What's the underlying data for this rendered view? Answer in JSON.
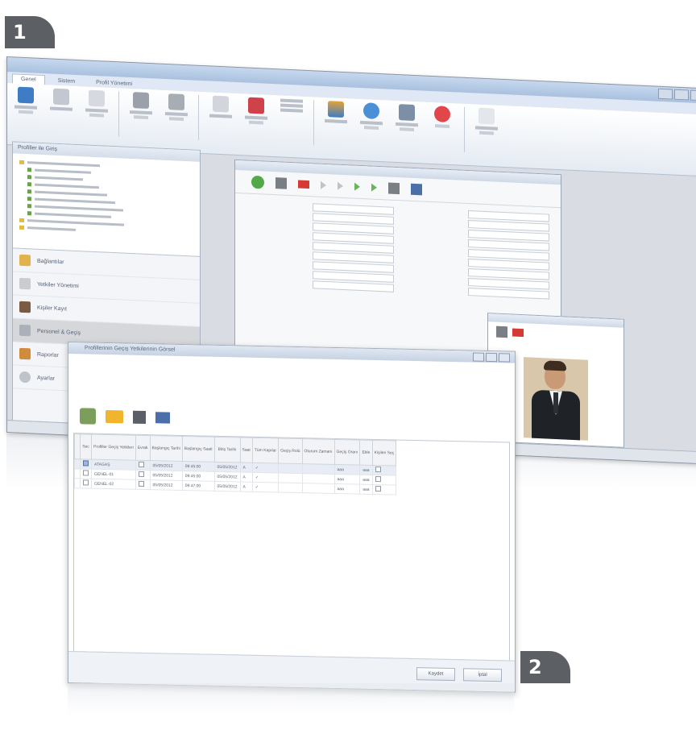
{
  "badges": {
    "one": "1",
    "two": "2"
  },
  "app": {
    "tabs": [
      "Genel",
      "Sistem",
      "Profil Yönetimi"
    ],
    "nav_header": "Profiller ile Giriş",
    "nav_items": [
      "Bağlantılar",
      "Yetkiler Yönetimi",
      "Kişiler Kayıt",
      "Personel & Geçiş",
      "Raporlar",
      "Ayarlar"
    ]
  },
  "dialog": {
    "title": "Profillerinin Geçiş Yetkilerinin Görsel",
    "ok": "Kaydet",
    "cancel": "İptal",
    "columns": [
      "Sec",
      "Profiller Geçiş Yetkileri",
      "Evrak",
      "Başlangıç Tarihi",
      "Başlangıç Saati",
      "Bitiş Tarihi",
      "Saat",
      "Tüm Kapılar",
      "Geçiş Rolü",
      "Oturum Zamanı",
      "Geçiş Oranı",
      "Ekle",
      "Kişileri Seç"
    ],
    "rows": [
      {
        "name": "ATAGAŞ",
        "date1": "05/05/2012",
        "time1": "09:45:00",
        "date2": "05/05/2012",
        "flag": "A",
        "val": "aaa",
        "n": "aaa"
      },
      {
        "name": "GENEL-01",
        "date1": "05/05/2012",
        "time1": "09:45:00",
        "date2": "05/05/2012",
        "flag": "A",
        "val": "aaa",
        "n": "aaa"
      },
      {
        "name": "GENEL-02",
        "date1": "05/05/2012",
        "time1": "09:47:00",
        "date2": "05/05/2012",
        "flag": "A",
        "val": "aaa",
        "n": "aaa"
      }
    ]
  },
  "colors": {
    "badge": "#5c5f63",
    "accent": "#4a72b8"
  }
}
